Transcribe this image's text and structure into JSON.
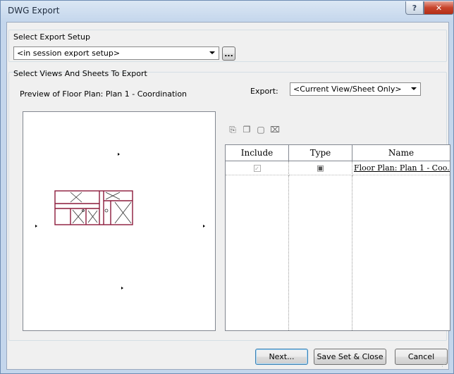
{
  "window": {
    "title": "DWG Export",
    "help_glyph": "?",
    "close_glyph": "✕"
  },
  "export_setup": {
    "group_label": "Select Export Setup",
    "selected": "<in session export setup>",
    "browse_label": "..."
  },
  "views": {
    "group_label": "Select Views And Sheets To Export",
    "preview_label": "Preview of Floor Plan: Plan 1 - Coordination",
    "export_label": "Export:",
    "export_selected": "<Current View/Sheet Only>"
  },
  "toolbar_icons": [
    "new-set-icon",
    "duplicate-set-icon",
    "rename-set-icon",
    "delete-set-icon"
  ],
  "table": {
    "columns": [
      "Include",
      "Type",
      "Name"
    ],
    "rows": [
      {
        "include": "✓",
        "type": "▣",
        "name": "Floor Plan: Plan 1 - Coo..."
      }
    ]
  },
  "buttons": {
    "next": "Next...",
    "save": "Save Set & Close",
    "cancel": "Cancel"
  },
  "colors": {
    "plan_lines": "#8b1a3a",
    "title_gradient_top": "#dbe7f4",
    "close_red": "#c7432b"
  }
}
